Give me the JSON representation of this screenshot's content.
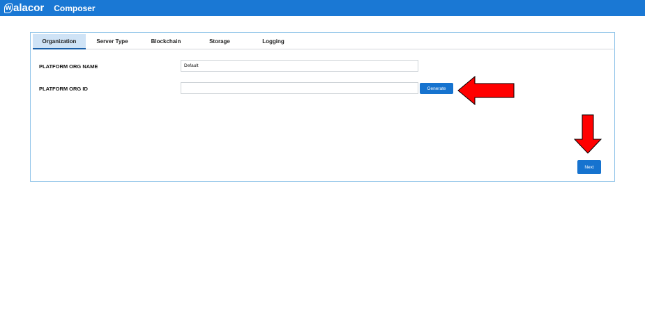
{
  "header": {
    "logo_text": "walacor",
    "app_title": "Composer",
    "bar_color": "#1a78d4"
  },
  "tabs": [
    {
      "label": "Organization",
      "active": true
    },
    {
      "label": "Server Type",
      "active": false
    },
    {
      "label": "Blockchain",
      "active": false
    },
    {
      "label": "Storage",
      "active": false
    },
    {
      "label": "Logging",
      "active": false
    }
  ],
  "form": {
    "org_name_label": "PLATFORM ORG NAME",
    "org_name_value": "Default",
    "org_id_label": "PLATFORM ORG ID",
    "org_id_value": "",
    "generate_label": "Generate"
  },
  "footer": {
    "next_label": "Next"
  },
  "annotations": {
    "arrow_color": "#ff0000",
    "arrow_left_icon": "red-arrow-left-icon",
    "arrow_down_icon": "red-arrow-down-icon"
  }
}
